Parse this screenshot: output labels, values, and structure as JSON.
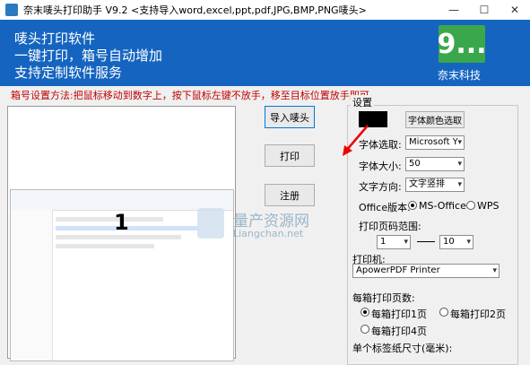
{
  "window": {
    "title": "奈末唛头打印助手   V9.2    <支持导入word,excel,ppt,pdf,JPG,BMP,PNG唛头>",
    "minimize_icon": "—",
    "maximize_icon": "☐",
    "close_icon": "✕"
  },
  "banner": {
    "line1": "唛头打印软件",
    "line2": "一键打印，箱号自动增加",
    "line3": "支持定制软件服务",
    "logo_glyph": "9...",
    "logo_text": "奈末科技"
  },
  "hint": "箱号设置方法:把鼠标移动到数字上，按下鼠标左键不放手，移至目标位置放手即可",
  "preview": {
    "box_number": "1"
  },
  "buttons": {
    "import": "导入唛头",
    "print": "打印",
    "register": "注册"
  },
  "watermark": {
    "cn": "量产资源网",
    "en": "Liangchan.net"
  },
  "settings": {
    "group_title": "设置",
    "font_color_button": "字体颜色选取",
    "font_label": "字体选取:",
    "font_value": "Microsoft Y",
    "size_label": "字体大小:",
    "size_value": "50",
    "direction_label": "文字方向:",
    "direction_value": "文字竖排",
    "office_label": "Office版本:",
    "office_opt1": "MS-Office",
    "office_opt2": "WPS",
    "page_range_label": "打印页码范围:",
    "page_from": "1",
    "page_dash": "—",
    "page_to": "10",
    "printer_label": "打印机:",
    "printer_value": "ApowerPDF Printer",
    "pages_per_box_label": "每箱打印页数:",
    "opt_1page": "每箱打印1页",
    "opt_2page": "每箱打印2页",
    "opt_4page": "每箱打印4页",
    "label_size_label": "单个标签纸尺寸(毫米):",
    "color_value": "#000000"
  }
}
